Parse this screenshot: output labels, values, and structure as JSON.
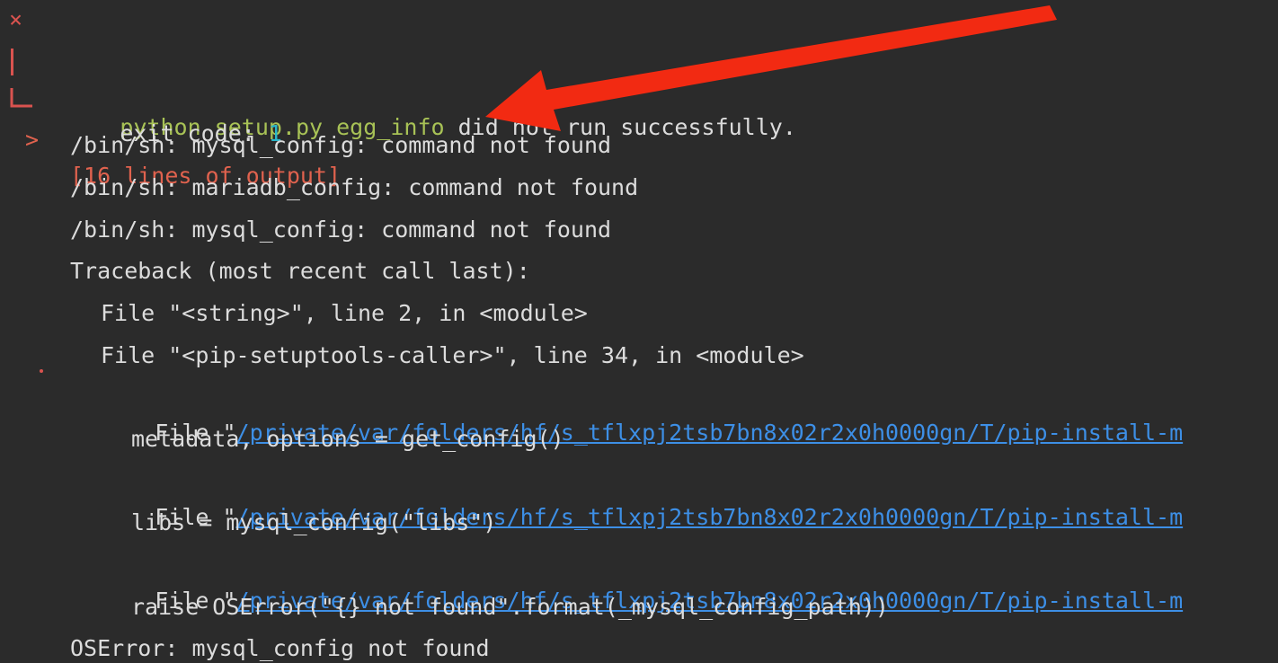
{
  "terminal": {
    "lines": {
      "error_mark": "×",
      "error_cmd": "python setup.py egg_info",
      "error_rest": " did not run successfully.",
      "exit_label": "exit code: ",
      "exit_value": "1",
      "output_arrow": ">",
      "output_count": "[16 lines of output]",
      "sh1": "/bin/sh: mysql_config: command not found",
      "sh2": "/bin/sh: mariadb_config: command not found",
      "sh3": "/bin/sh: mysql_config: command not found",
      "traceback": "Traceback (most recent call last):",
      "file1": "File \"<string>\", line 2, in <module>",
      "file2": "File \"<pip-setuptools-caller>\", line 34, in <module>",
      "file3_prefix": "File \"",
      "file3_link": "/private/var/folders/hf/s_tflxpj2tsb7bn8x02r2x0h0000gn/T/pip-install-m",
      "code1": "metadata, options = get_config()",
      "file4_prefix": "File \"",
      "file4_link": "/private/var/folders/hf/s_tflxpj2tsb7bn8x02r2x0h0000gn/T/pip-install-m",
      "code2": "libs = mysql_config(\"libs\")",
      "file5_prefix": "File \"",
      "file5_link": "/private/var/folders/hf/s_tflxpj2tsb7bn8x02r2x0h0000gn/T/pip-install-m",
      "code3": "raise OSError(\"{} not found\".format(_mysql_config_path))",
      "final_error": "OSError: mysql_config not found"
    },
    "colors": {
      "background": "#2b2b2b",
      "command": "#a8c256",
      "exit_code": "#2ab7ca",
      "output_count": "#e0624e",
      "link": "#3d8fe6",
      "annotation_arrow": "#f22a12"
    }
  }
}
